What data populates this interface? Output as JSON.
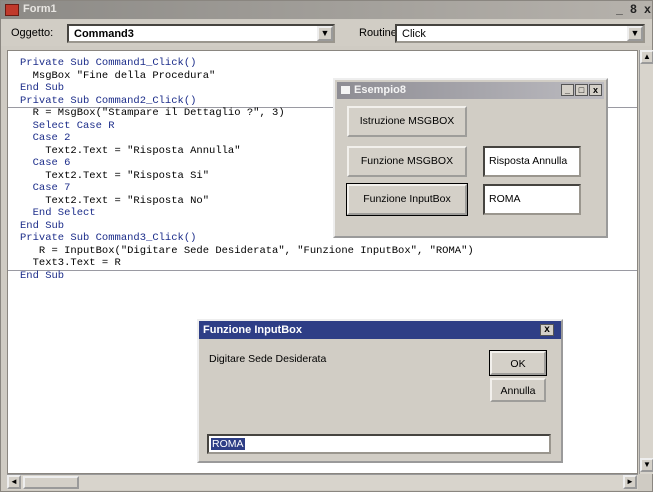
{
  "window": {
    "title": "Form1",
    "min_glyph": "_",
    "max_glyph": "8",
    "close_glyph": "x"
  },
  "combos": {
    "object_label": "Oggetto:",
    "object_value": "Command3",
    "routine_label": "Routine:",
    "routine_value": "Click",
    "arrow_glyph": "▼"
  },
  "code": {
    "block1": [
      {
        "text": "Private Sub Command1_Click()",
        "kw": true
      },
      {
        "text": "  MsgBox \"Fine della Procedura\"",
        "kw": false
      },
      {
        "text": "End Sub",
        "kw": true
      }
    ],
    "block2": [
      {
        "text": "Private Sub Command2_Click()",
        "kw": true
      },
      {
        "text": "  R = MsgBox(\"Stampare il Dettaglio ?\", 3)",
        "kw": false
      },
      {
        "text": "  Select Case R",
        "kw": true
      },
      {
        "text": "  Case 2",
        "kw": true
      },
      {
        "text": "    Text2.Text = \"Risposta Annulla\"",
        "kw": false
      },
      {
        "text": "  Case 6",
        "kw": true
      },
      {
        "text": "    Text2.Text = \"Risposta Si\"",
        "kw": false
      },
      {
        "text": "  Case 7",
        "kw": true
      },
      {
        "text": "    Text2.Text = \"Risposta No\"",
        "kw": false
      },
      {
        "text": "  End Select",
        "kw": true
      },
      {
        "text": "End Sub",
        "kw": true
      }
    ],
    "block3": [
      {
        "text": "Private Sub Command3_Click()",
        "kw": true
      },
      {
        "text": "   R = InputBox(\"Digitare Sede Desiderata\", \"Funzione InputBox\", \"ROMA\")",
        "kw": false
      },
      {
        "text": "  Text3.Text = R",
        "kw": false
      },
      {
        "text": "End Sub",
        "kw": true
      }
    ]
  },
  "form8": {
    "title": "Esempio8",
    "min_glyph": "_",
    "max_glyph": "□",
    "close_glyph": "x",
    "btn_istruzione": "Istruzione MSGBOX",
    "btn_funzione_msgbox": "Funzione MSGBOX",
    "btn_funzione_inputbox": "Funzione InputBox",
    "text2": "Risposta Annulla",
    "text3": "ROMA"
  },
  "inputbox": {
    "title": "Funzione InputBox",
    "close_glyph": "x",
    "prompt": "Digitare Sede Desiderata",
    "ok": "OK",
    "annulla": "Annulla",
    "value": "ROMA"
  },
  "scroll": {
    "up": "▲",
    "down": "▼",
    "left": "◄",
    "right": "►"
  }
}
